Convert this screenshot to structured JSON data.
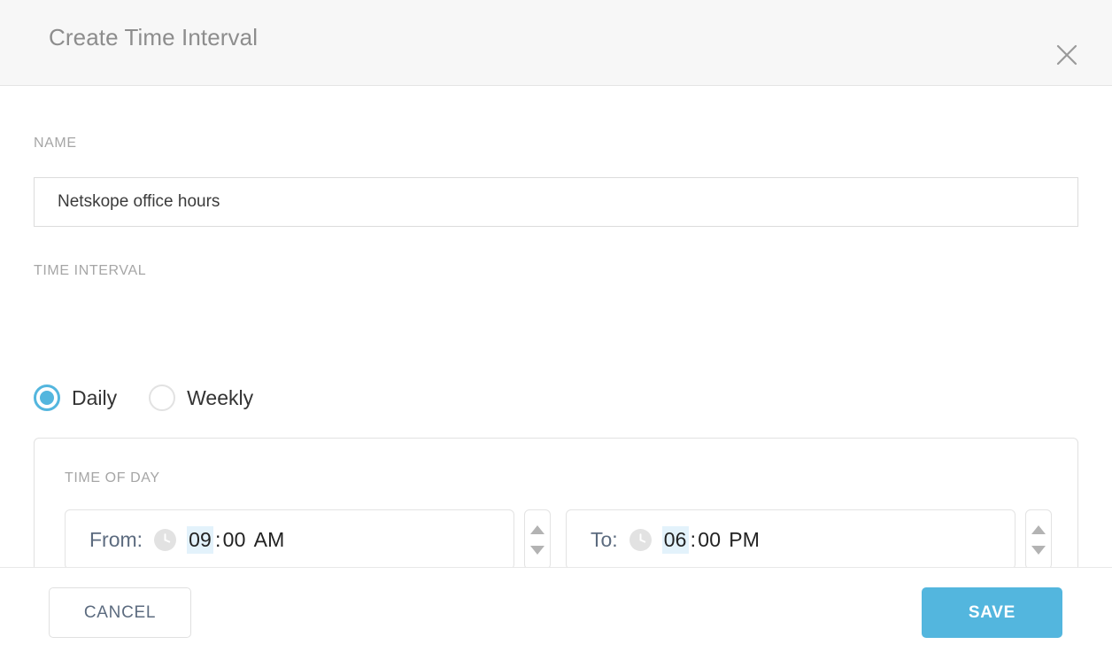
{
  "dialog": {
    "title": "Create Time Interval",
    "close_icon": "close-icon"
  },
  "form": {
    "name": {
      "label": "NAME",
      "value": "Netskope office hours",
      "placeholder": ""
    },
    "time_interval": {
      "label": "TIME INTERVAL",
      "options": [
        {
          "label": "Daily",
          "selected": true
        },
        {
          "label": "Weekly",
          "selected": false
        }
      ]
    },
    "time_of_day": {
      "label": "TIME OF DAY",
      "from": {
        "prefix": "From:",
        "icon": "clock-icon",
        "hour": "09",
        "colon": ":",
        "minute": "00",
        "meridiem": "AM"
      },
      "to": {
        "prefix": "To:",
        "icon": "clock-icon",
        "hour": "06",
        "colon": ":",
        "minute": "00",
        "meridiem": "PM"
      }
    }
  },
  "footer": {
    "cancel_label": "CANCEL",
    "save_label": "SAVE"
  },
  "colors": {
    "accent": "#53b6de",
    "header_bg": "#f7f7f7",
    "label_gray": "#a6a6a6",
    "selection_highlight": "#e3f2fb",
    "slate_text": "#5c6b7f"
  }
}
